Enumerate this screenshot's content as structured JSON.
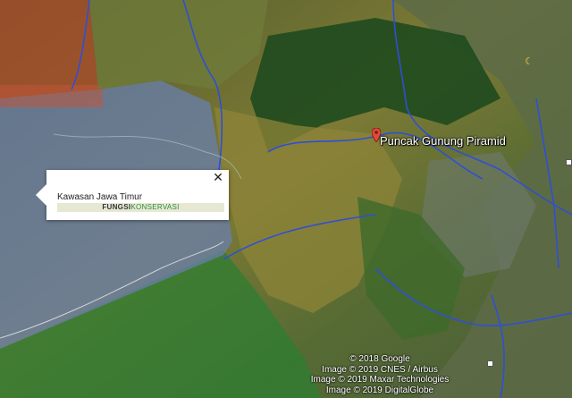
{
  "popup": {
    "title": "Kawasan Jawa Timur",
    "field_key": "FUNGSI",
    "field_value": "KONSERVASI",
    "close_symbol": "✕"
  },
  "place": {
    "name": "Puncak Gunung Piramid",
    "icon": "map-pin-icon"
  },
  "attribution": [
    "© 2018 Google",
    "Image © 2019 CNES / Airbus",
    "Image © 2019 Maxar Technologies",
    "Image © 2019 DigitalGlobe"
  ],
  "colors": {
    "conservation_overlay": "#6a7fb3",
    "protected_forest_overlay": "#2e7d32",
    "production_overlay": "#b34a2a",
    "boundary_line": "#2f4fd6",
    "label_text": "#ffffff"
  }
}
